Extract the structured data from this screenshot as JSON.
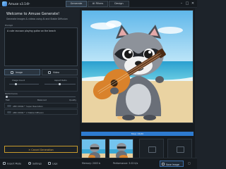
{
  "app": {
    "title": "Amuse v3.1.0",
    "version": "beta"
  },
  "nav": {
    "tabs": [
      "Generate",
      "AI Filters",
      "Design"
    ],
    "active": 0
  },
  "window": {
    "minimize": "–",
    "maximize": "□",
    "close": "✕"
  },
  "welcome": {
    "title": "Welcome to Amuse Generate!",
    "subtitle": "Generate images & videos using AI and Stable Diffusion"
  },
  "prompt": {
    "label": "Prompt",
    "value": "A cute raccoon playing guitar on the beach"
  },
  "mode_tabs": [
    {
      "label": "Image",
      "icon": "image-icon",
      "active": true
    },
    {
      "label": "Video",
      "icon": "video-icon",
      "active": false
    }
  ],
  "settings": {
    "image_count_label": "Image Count",
    "aspect_ratio_label": "Aspect Ratio",
    "performance_label": "Performance",
    "slider_fast": "Fast",
    "slider_balanced": "Balanced",
    "slider_quality": "Quality"
  },
  "toggles": [
    {
      "label": "AMD XDNA™ Super Resolution",
      "on": false
    },
    {
      "label": "AMD XDNA™ 2 Stable Diffusion",
      "on": false
    }
  ],
  "cancel_label": "✕ Cancel Generation",
  "progress": {
    "text": "Step: 16/20",
    "fraction": 0.8
  },
  "statusbar": {
    "expert_mode": "Expert Mode",
    "settings": "Settings",
    "logs": "Logs",
    "memory": "Memory: 2003 b",
    "performance": "Performance: 3.02 it/s",
    "save": "Save Image"
  },
  "colors": {
    "accent": "#2e7bd0",
    "cancel": "#e4b24a",
    "background": "#1d232a"
  }
}
